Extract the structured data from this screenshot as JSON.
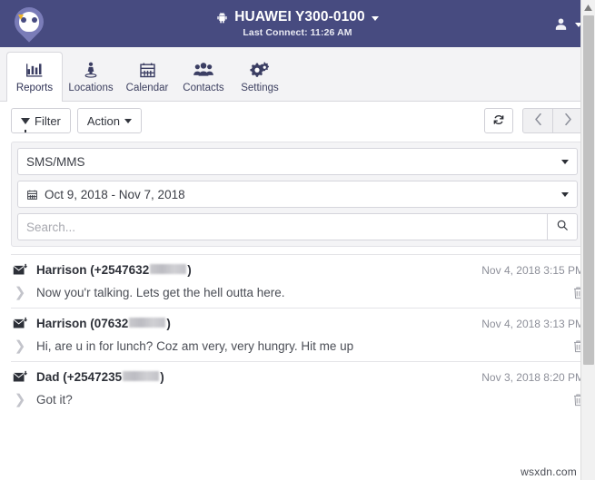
{
  "header": {
    "logo_name": "owl-pin-logo",
    "device_icon": "android-icon",
    "device_title": "HUAWEI Y300-0100",
    "last_connect": "Last Connect: 11:26 AM",
    "account_icon": "user-avatar-icon",
    "bg_color": "#474b80"
  },
  "tabs": [
    {
      "label": "Reports",
      "icon": "bar-chart-icon",
      "active": true
    },
    {
      "label": "Locations",
      "icon": "person-pin-icon",
      "active": false
    },
    {
      "label": "Calendar",
      "icon": "calendar-icon",
      "active": false
    },
    {
      "label": "Contacts",
      "icon": "contacts-group-icon",
      "active": false
    },
    {
      "label": "Settings",
      "icon": "gears-icon",
      "active": false
    }
  ],
  "toolbar": {
    "filter_label": "Filter",
    "action_label": "Action",
    "refresh_icon": "refresh-icon",
    "prev_icon": "chevron-left-icon",
    "next_icon": "chevron-right-icon"
  },
  "filters": {
    "type_value": "SMS/MMS",
    "date_range": "Oct 9, 2018 - Nov 7, 2018",
    "date_icon": "calendar-icon",
    "search_value": "",
    "search_placeholder": "Search...",
    "search_icon": "search-icon"
  },
  "messages": [
    {
      "icon": "incoming-message-icon",
      "sender_prefix": "Harrison (+2547632",
      "sender_suffix": ")",
      "timestamp": "Nov 4, 2018 3:15 PM",
      "body": "Now you'r talking. Lets get the hell outta here.",
      "expand_icon": "chevron-right-icon",
      "delete_icon": "trash-icon"
    },
    {
      "icon": "incoming-message-icon",
      "sender_prefix": "Harrison (07632",
      "sender_suffix": ")",
      "timestamp": "Nov 4, 2018 3:13 PM",
      "body": "Hi, are u in for lunch? Coz am very, very hungry. Hit me up",
      "expand_icon": "chevron-right-icon",
      "delete_icon": "trash-icon"
    },
    {
      "icon": "incoming-message-icon",
      "sender_prefix": "Dad (+2547235",
      "sender_suffix": ")",
      "timestamp": "Nov 3, 2018 8:20 PM",
      "body": "Got it?",
      "expand_icon": "chevron-right-icon",
      "delete_icon": "trash-icon"
    }
  ],
  "watermark": "wsxdn.com"
}
